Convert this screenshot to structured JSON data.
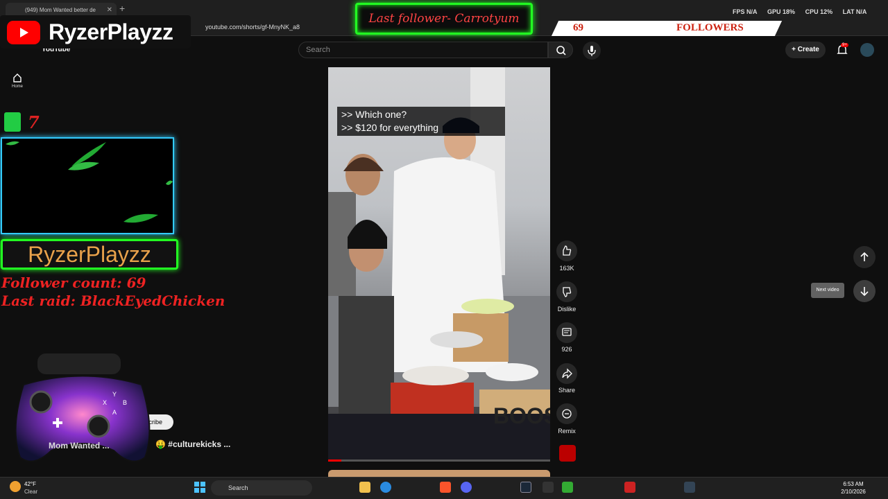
{
  "browser": {
    "tab_title": "(949) Mom Wanted better de",
    "url": "youtube.com/shorts/gf-MnyNK_a8"
  },
  "stats": {
    "fps": "FPS N/A",
    "gpu": "GPU 18%",
    "cpu": "CPU 12%",
    "lat": "LAT N/A"
  },
  "youtube": {
    "logo": "YouTube",
    "search_placeholder": "Search",
    "create_label": "Create",
    "bell_badge": "9+",
    "home_label": "Home"
  },
  "overlay": {
    "channel_name": "RyzerPlayzz",
    "last_follower": "Last follower- Carrotyum",
    "followers_count": "69",
    "followers_label": "FOLLOWERS",
    "counter_value": "7",
    "box_name": "RyzerPlayzz",
    "follower_count_line": "Follower count: 69",
    "last_raid_line": "Last raid: BlackEyedChicken"
  },
  "video": {
    "caption_line1": ">> Which one?",
    "caption_line2": ">> $120 for everything",
    "channel_title": "Mom Wanted ...",
    "subscribe_label": "scribe",
    "hashtag": "#culturekicks ...",
    "progress": 0.06,
    "sign_text": "BOOS"
  },
  "actions": {
    "like_count": "163K",
    "dislike_label": "Dislike",
    "comment_count": "926",
    "share_label": "Share",
    "remix_label": "Remix",
    "next_tooltip": "Next video"
  },
  "taskbar": {
    "weather_temp": "42°F",
    "weather_cond": "Clear",
    "search_label": "Search",
    "time": "6:53 AM",
    "date": "2/10/2026"
  }
}
